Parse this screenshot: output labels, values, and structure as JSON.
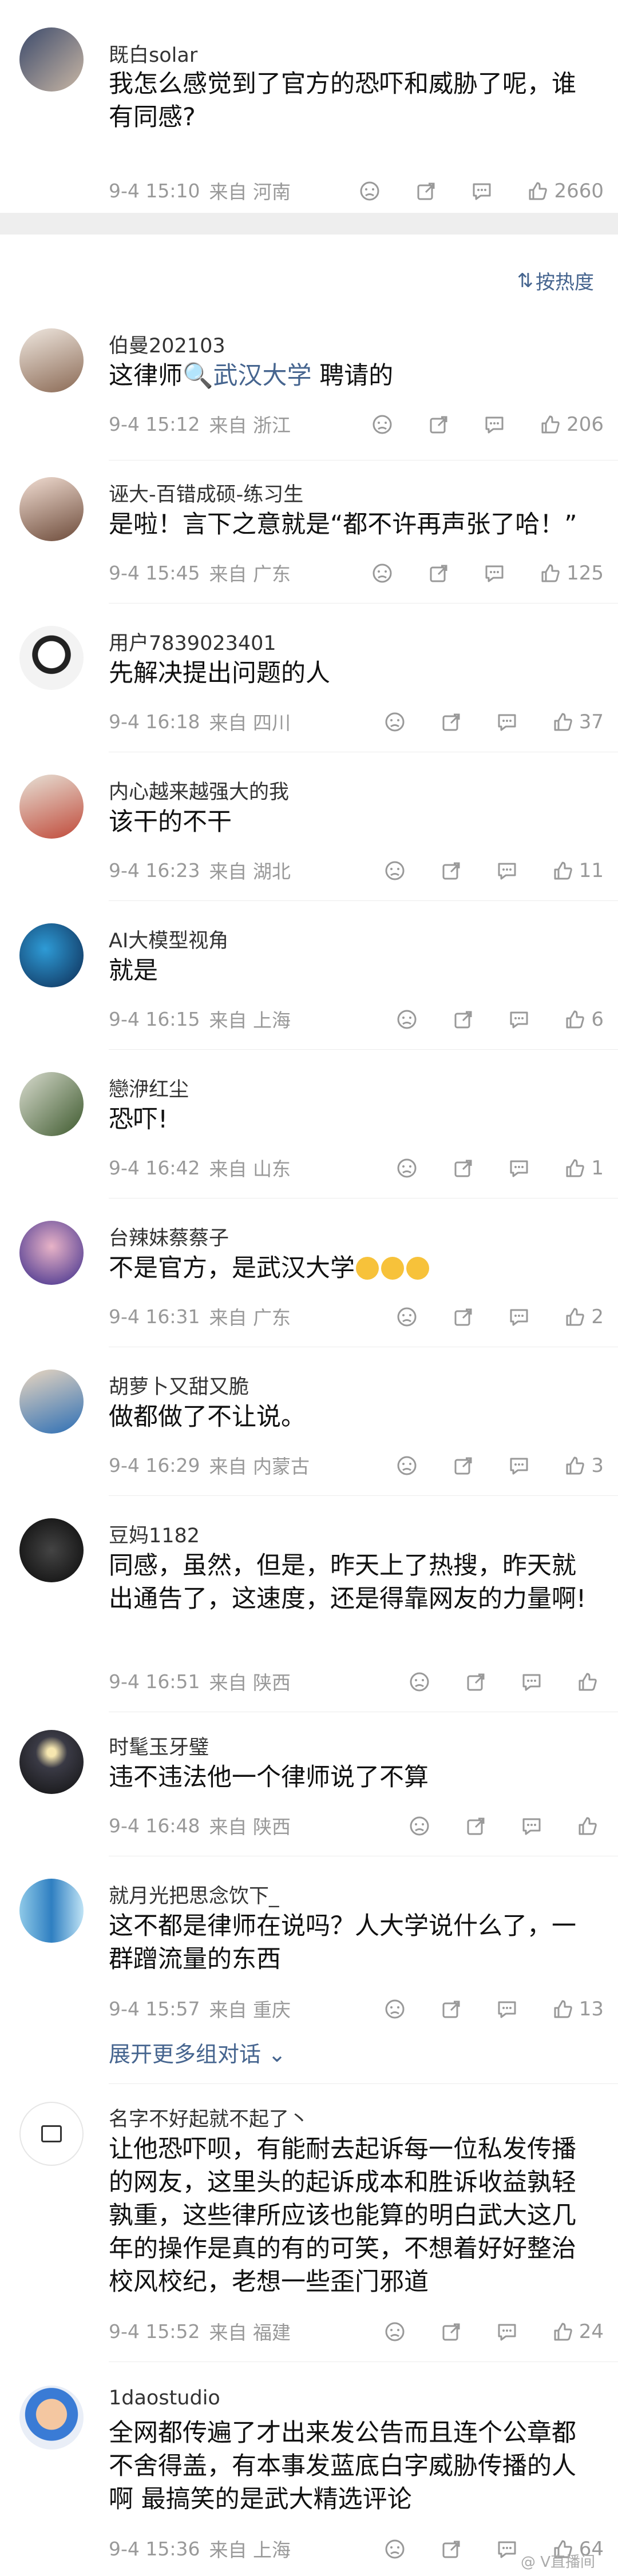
{
  "top_comment": {
    "name": "既白solar",
    "text": "我怎么感觉到了官方的恐吓和威胁了呢，谁有同感?",
    "time": "9-4 15:10",
    "location": "来自 河南",
    "likes": "2660"
  },
  "sort_label": "按热度",
  "comments": [
    {
      "name": "伯曼202103",
      "text_before": "这律师",
      "keyword": "武汉大学",
      "text_after": " 聘请的",
      "time": "9-4 15:12",
      "location": "来自 浙江",
      "likes": "206"
    },
    {
      "name": "诬大-百错成硕-练习生",
      "text": "是啦！言下之意就是“都不许再声张了哈！”",
      "time": "9-4 15:45",
      "location": "来自 广东",
      "likes": "125"
    },
    {
      "name": "用户7839023401",
      "text": "先解决提出问题的人",
      "time": "9-4 16:18",
      "location": "来自 四川",
      "likes": "37"
    },
    {
      "name": "内心越来越强大的我",
      "text": "该干的不干",
      "time": "9-4 16:23",
      "location": "来自 湖北",
      "likes": "11"
    },
    {
      "name": "AI大模型视角",
      "text": "就是",
      "time": "9-4 16:15",
      "location": "来自 上海",
      "likes": "6"
    },
    {
      "name": "戀洢红尘",
      "text": "恐吓!",
      "time": "9-4 16:42",
      "location": "来自 山东",
      "likes": "1"
    },
    {
      "name": "台辣妹蔡蔡子",
      "text": "不是官方，是武汉大学",
      "time": "9-4 16:31",
      "location": "来自 广东",
      "likes": "2"
    },
    {
      "name": "胡萝卜又甜又脆",
      "text": "做都做了不让说。",
      "time": "9-4 16:29",
      "location": "来自 内蒙古",
      "likes": "3"
    },
    {
      "name": "豆妈1182",
      "text": "同感，虽然，但是，昨天上了热搜，昨天就出通告了，这速度，还是得靠网友的力量啊!",
      "time": "9-4 16:51",
      "location": "来自 陕西",
      "likes": ""
    },
    {
      "name": "时髦玉牙璧",
      "text": "违不违法他一个律师说了不算",
      "time": "9-4 16:48",
      "location": "来自 陕西",
      "likes": ""
    },
    {
      "name": "就月光把思念饮下_",
      "text": "这不都是律师在说吗？人大学说什么了，一群蹭流量的东西",
      "time": "9-4 15:57",
      "location": "来自 重庆",
      "likes": "13"
    },
    {
      "name": "名字不好起就不起了丶",
      "text": "让他恐吓呗，有能耐去起诉每一位私发传播的网友，这里头的起诉成本和胜诉收益孰轻孰重，这些律所应该也能算的明白武大这几年的操作是真的有的可笑，不想着好好整治校风校纪，老想一些歪门邪道",
      "time": "9-4 15:52",
      "location": "来自 福建",
      "likes": "24"
    },
    {
      "name": "1daostudio",
      "text": "全网都传遍了才出来发公告而且连个公章都不舍得盖，有本事发蓝底白字威胁传播的人啊 最搞笑的是武大精选评论",
      "time": "9-4 15:36",
      "location": "来自 上海",
      "likes": "64"
    }
  ],
  "expand_more": "展开更多组对话",
  "watermark": "@ V直播间"
}
